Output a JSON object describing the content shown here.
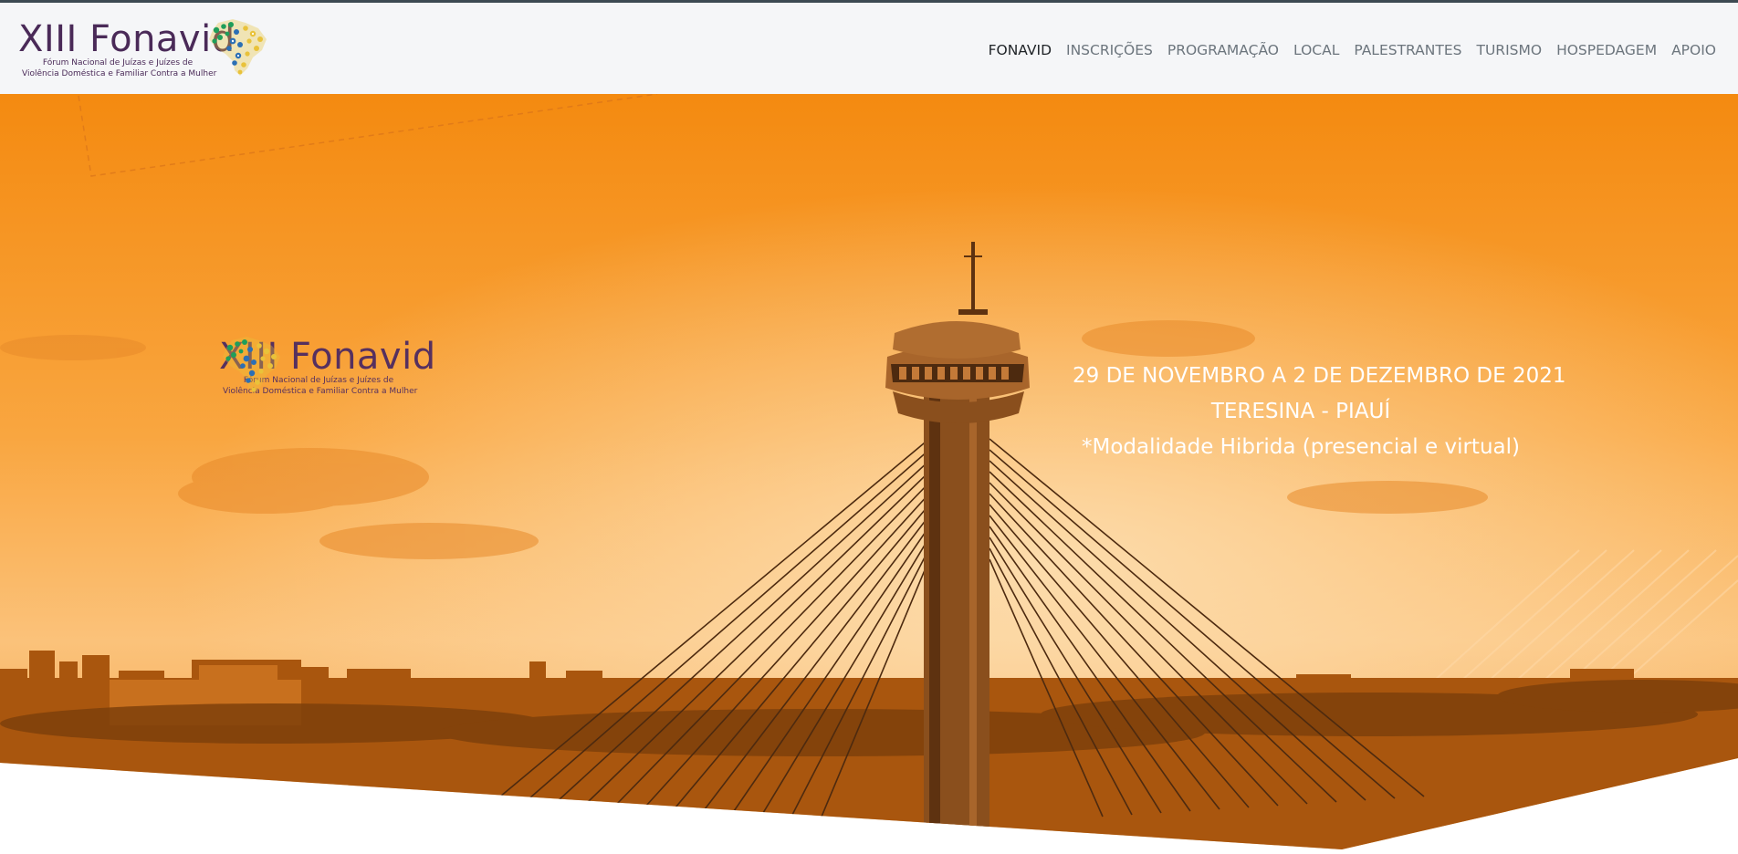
{
  "site": {
    "logo": {
      "title": "XIII Fonavid",
      "subtitle_line1": "Fórum Nacional de Juízas e Juízes de",
      "subtitle_line2": "Violência Doméstica e Familiar Contra a Mulher"
    }
  },
  "nav": {
    "items": [
      {
        "label": "FONAVID",
        "active": true
      },
      {
        "label": "INSCRIÇÕES",
        "active": false
      },
      {
        "label": "PROGRAMAÇÃO",
        "active": false
      },
      {
        "label": "LOCAL",
        "active": false
      },
      {
        "label": "PALESTRANTES",
        "active": false
      },
      {
        "label": "TURISMO",
        "active": false
      },
      {
        "label": "HOSPEDAGEM",
        "active": false
      },
      {
        "label": "APOIO",
        "active": false
      }
    ]
  },
  "hero": {
    "event": {
      "dates": "29 DE NOVEMBRO A 2 DE DEZEMBRO DE 2021",
      "location": "TERESINA - PIAUÍ",
      "modality": "*Modalidade Hibrida (presencial e virtual)"
    }
  },
  "colors": {
    "brand_purple": "#4a2a58",
    "hero_orange": "#f7941d",
    "header_bg": "#f5f6f8",
    "nav_text": "#6c757d",
    "nav_active": "#1f2327"
  }
}
